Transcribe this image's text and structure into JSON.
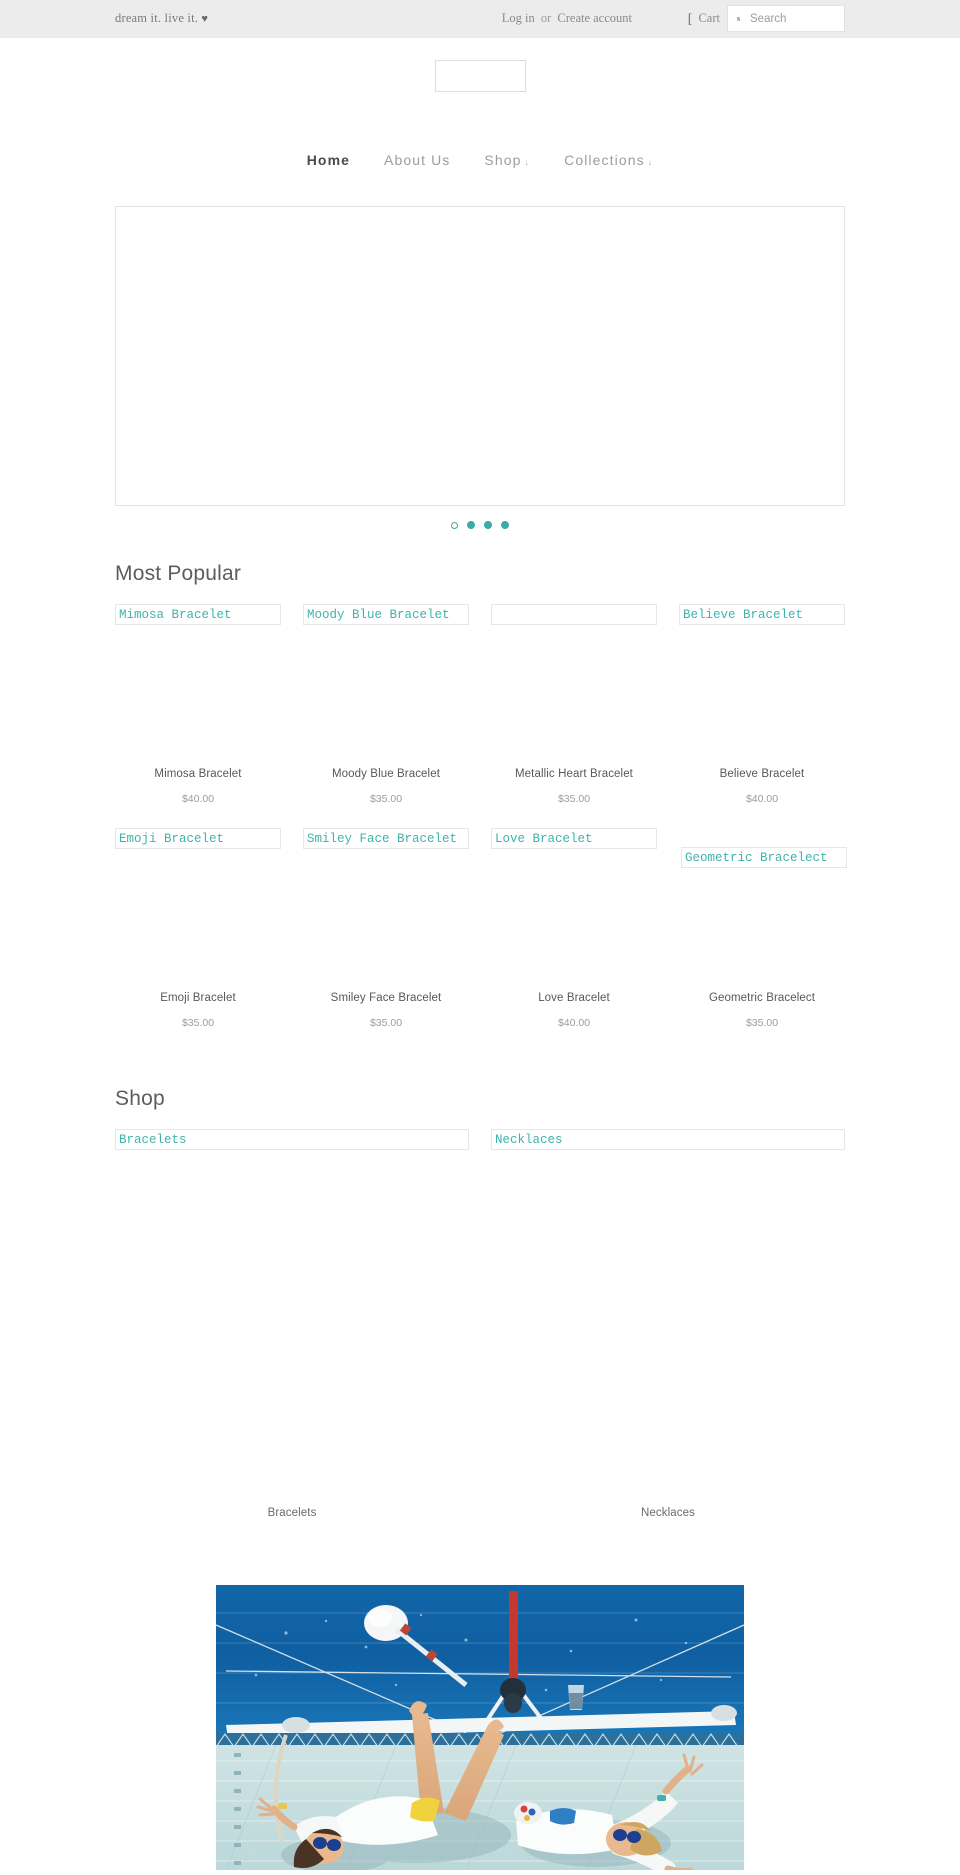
{
  "topbar": {
    "tagline": "dream it. live it.",
    "tagline_heart": "♥",
    "login_label": "Log in",
    "or_label": "or",
    "create_account_label": "Create account",
    "cart_label": "Cart",
    "cart_icon": "cart-icon-fallback",
    "cart_icon_glyph": "[",
    "search_icon": "search-icon-fallback",
    "search_icon_glyph": "s",
    "search_placeholder": "Search",
    "search_value": ""
  },
  "header": {
    "logo_alt": ""
  },
  "nav": {
    "items": [
      {
        "label": "Home",
        "active": true,
        "has_caret": false
      },
      {
        "label": "About Us",
        "active": false,
        "has_caret": false
      },
      {
        "label": "Shop",
        "active": false,
        "has_caret": true
      },
      {
        "label": "Collections",
        "active": false,
        "has_caret": true
      }
    ],
    "caret_glyph": "↓"
  },
  "hero": {
    "slide_alt": "",
    "dots": [
      {
        "active": true
      },
      {
        "active": false
      },
      {
        "active": false
      },
      {
        "active": false
      }
    ]
  },
  "most_popular": {
    "title": "Most Popular",
    "products": [
      {
        "alt": "Mimosa Bracelet",
        "title": "Mimosa Bracelet",
        "price": "$40.00",
        "offset": false
      },
      {
        "alt": "Moody Blue Bracelet",
        "title": "Moody Blue Bracelet",
        "price": "$35.00",
        "offset": false
      },
      {
        "alt": "",
        "title": "Metallic Heart Bracelet",
        "price": "$35.00",
        "offset": false
      },
      {
        "alt": "Believe Bracelet",
        "title": "Believe Bracelet",
        "price": "$40.00",
        "offset": false
      },
      {
        "alt": "Emoji Bracelet",
        "title": "Emoji Bracelet",
        "price": "$35.00",
        "offset": false
      },
      {
        "alt": "Smiley Face Bracelet",
        "title": "Smiley Face Bracelet",
        "price": "$35.00",
        "offset": false
      },
      {
        "alt": "Love Bracelet",
        "title": "Love Bracelet",
        "price": "$40.00",
        "offset": false
      },
      {
        "alt": "Geometric Bracelect",
        "title": "Geometric Bracelect",
        "price": "$35.00",
        "offset": true
      }
    ]
  },
  "shop": {
    "title": "Shop",
    "collections": [
      {
        "alt": "Bracelets",
        "caption": "Bracelets"
      },
      {
        "alt": "Necklaces",
        "caption": "Necklaces"
      }
    ]
  },
  "lifestyle_photo": {
    "alt": "two women in white shirts lying on the deck of a sailboat on blue water"
  },
  "colors": {
    "accent_teal": "#3fb3ab",
    "topbar_bg": "#ececec",
    "text_muted": "#9d9d9d",
    "text_dark": "#4a4a4a"
  }
}
